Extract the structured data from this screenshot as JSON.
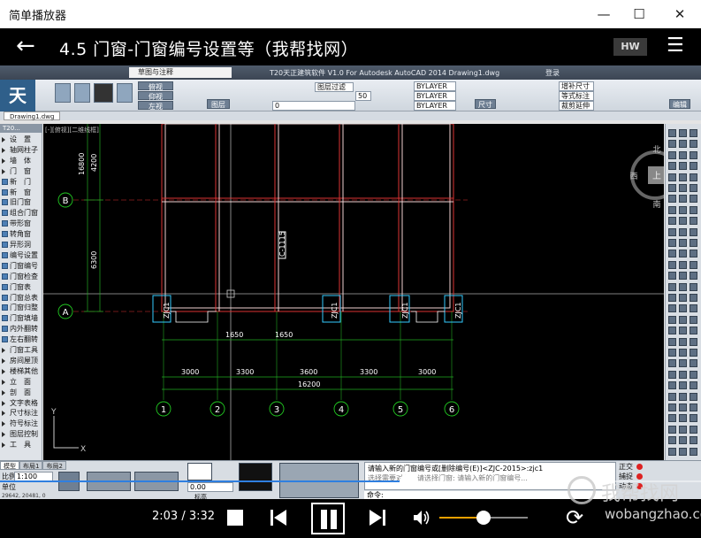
{
  "window": {
    "title": "简单播放器",
    "minimize_glyph": "—",
    "maximize_glyph": "☐",
    "close_glyph": "✕"
  },
  "player": {
    "back_glyph": "←",
    "video_title": "4.5 门窗-门窗编号设置等（我帮找网）",
    "quality_badge": "HW",
    "menu_glyph": "☰",
    "current_time": "2:03",
    "separator": "/",
    "duration": "3:32",
    "progress_fraction": 0.58,
    "volume_fraction": 0.5,
    "loop_glyph": "⟳",
    "colors": {
      "seek_fill": "#2f7fe0",
      "volume_fill": "#f0a000"
    }
  },
  "watermark": {
    "name": "我帮找网",
    "domain": "wobangzhao.com"
  },
  "autocad": {
    "app_title": "T20天正建筑软件 V1.0 For Autodesk AutoCAD 2014    Drawing1.dwg",
    "workspace": "草图与注释",
    "login": "登录",
    "logo_glyph": "天",
    "file_tab": "Drawing1.dwg",
    "layer_value": "0",
    "bylayer": [
      "BYLAYER",
      "BYLAYER",
      "BYLAYER"
    ],
    "view_buttons": [
      "俯视",
      "仰视",
      "左视"
    ],
    "panel_labels": [
      "图层",
      "尺寸",
      "编辑"
    ],
    "right_buttons": [
      "增补尺寸",
      "等式标注",
      "裁剪延伸"
    ],
    "filter_box": "图层过滤",
    "filter_num": "50",
    "viewport_label": "[-][俯视][二维线框]",
    "palette_title": "T20...",
    "palette_items": [
      {
        "label": "设　置",
        "tri": true
      },
      {
        "label": "轴网柱子",
        "tri": true
      },
      {
        "label": "墙　体",
        "tri": true
      },
      {
        "label": "门　窗",
        "tri": true
      },
      {
        "label": "新　门",
        "tri": false
      },
      {
        "label": "新　窗",
        "tri": false
      },
      {
        "label": "旧门窗",
        "tri": false
      },
      {
        "label": "组合门窗",
        "tri": false
      },
      {
        "label": "带形窗",
        "tri": false
      },
      {
        "label": "转角窗",
        "tri": false
      },
      {
        "label": "异形洞",
        "tri": false
      },
      {
        "label": "编号设置",
        "tri": false
      },
      {
        "label": "门窗编号",
        "tri": false
      },
      {
        "label": "门窗检查",
        "tri": false
      },
      {
        "label": "门窗表",
        "tri": false
      },
      {
        "label": "门窗总表",
        "tri": false
      },
      {
        "label": "门窗归整",
        "tri": false
      },
      {
        "label": "门窗填墙",
        "tri": false
      },
      {
        "label": "内外翻转",
        "tri": false
      },
      {
        "label": "左右翻转",
        "tri": false
      },
      {
        "label": "门窗工具",
        "tri": true
      },
      {
        "label": "房间屋顶",
        "tri": true
      },
      {
        "label": "楼梯其他",
        "tri": true
      },
      {
        "label": "立　面",
        "tri": true
      },
      {
        "label": "剖　面",
        "tri": true
      },
      {
        "label": "文字表格",
        "tri": true
      },
      {
        "label": "尺寸标注",
        "tri": true
      },
      {
        "label": "符号标注",
        "tri": true
      },
      {
        "label": "图层控制",
        "tri": true
      },
      {
        "label": "工　具",
        "tri": true
      }
    ],
    "drawing": {
      "axis_rows": [
        "B",
        "A"
      ],
      "axis_cols": [
        "1",
        "2",
        "3",
        "4",
        "5",
        "6"
      ],
      "dim_vertical": [
        "16800",
        "4200",
        "6300"
      ],
      "dim_sub": [
        "1650",
        "1650"
      ],
      "dim_spans": [
        "3000",
        "3300",
        "3600",
        "3300",
        "3000"
      ],
      "dim_total": "16200",
      "window_tags": [
        "ZJC1",
        "ZJC1",
        "ZJC1",
        "ZJC1"
      ],
      "door_tag": "C-1115",
      "compass": {
        "north": "北",
        "west": "西",
        "south": "南",
        "top": "上"
      },
      "ucs_x": "X",
      "ucs_y": "Y"
    },
    "model_tabs": [
      "模型",
      "布局1",
      "布局2"
    ],
    "scale_label": "比例",
    "scale_value": "1:100",
    "unit_label": "单位",
    "height_label": "标高",
    "elev_value": "0.00",
    "coords": "29642, 20481, 0",
    "command_history": "请输入新的门窗编号或[删除编号(E)]<ZJC-2015>:zjc1",
    "command_history2": "选择需要对象。请选择门窗: 请输入新的门窗编号...",
    "command_prompt": "命令:",
    "status_right": [
      "正交",
      "捕捉",
      "动态"
    ]
  }
}
